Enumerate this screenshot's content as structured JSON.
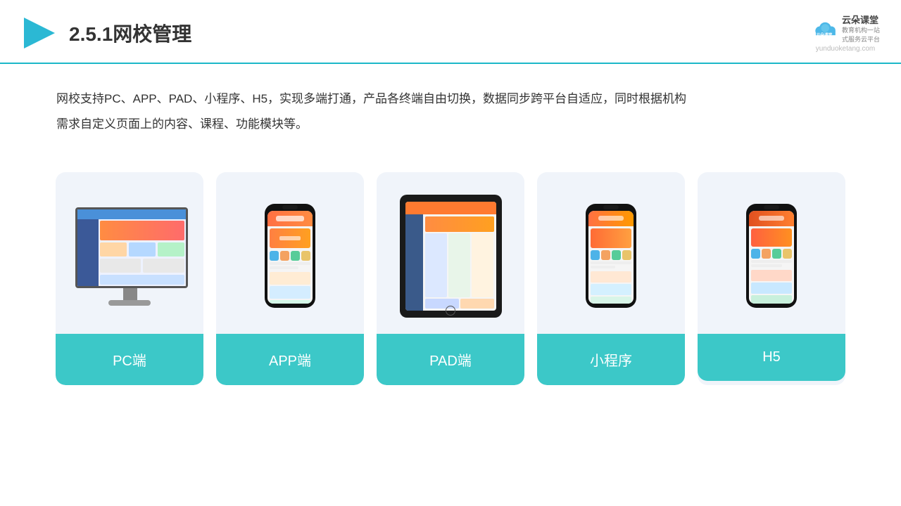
{
  "header": {
    "title": "2.5.1网校管理",
    "logo": {
      "brand": "云朵课堂",
      "tagline": "教育机构一站\n式服务云平台",
      "url": "yunduoketang.com"
    }
  },
  "description": {
    "text": "网校支持PC、APP、PAD、小程序、H5，实现多端打通，产品各终端自由切换，数据同步跨平台自适应，同时根据机构需求自定义页面上的内容、课程、功能模块等。"
  },
  "cards": [
    {
      "id": "pc",
      "label": "PC端",
      "type": "monitor"
    },
    {
      "id": "app",
      "label": "APP端",
      "type": "phone"
    },
    {
      "id": "pad",
      "label": "PAD端",
      "type": "tablet"
    },
    {
      "id": "miniprogram",
      "label": "小程序",
      "type": "phone"
    },
    {
      "id": "h5",
      "label": "H5",
      "type": "phone"
    }
  ],
  "brand_color": "#3cc8c8",
  "bg_color": "#f0f4fa"
}
